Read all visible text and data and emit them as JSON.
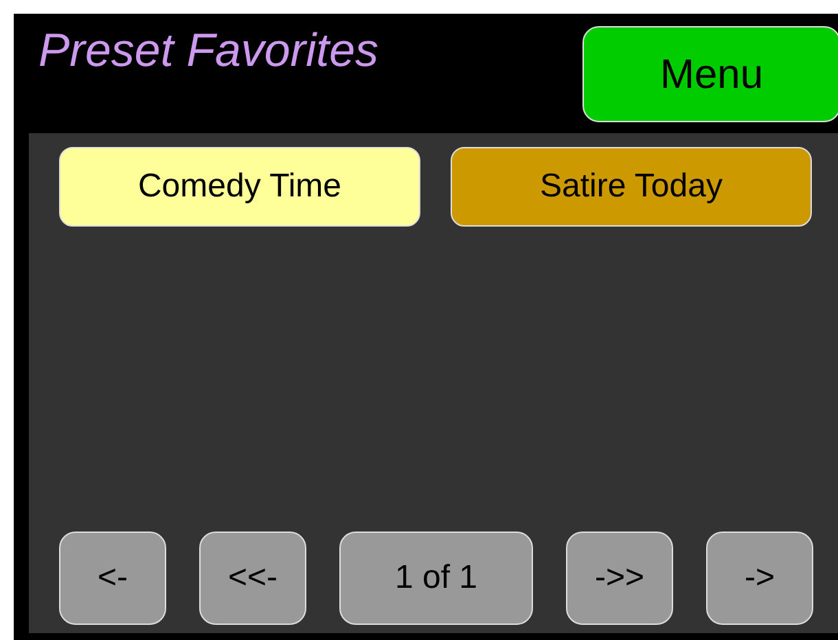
{
  "title": "Preset Favorites",
  "menu_button": "Menu",
  "presets": [
    {
      "label": "Comedy Time",
      "selected": true
    },
    {
      "label": "Satire Today",
      "selected": false
    }
  ],
  "pager": {
    "first": "<-",
    "prev": "<<-",
    "page": "1 of 1",
    "next": "->>",
    "last": "->"
  }
}
